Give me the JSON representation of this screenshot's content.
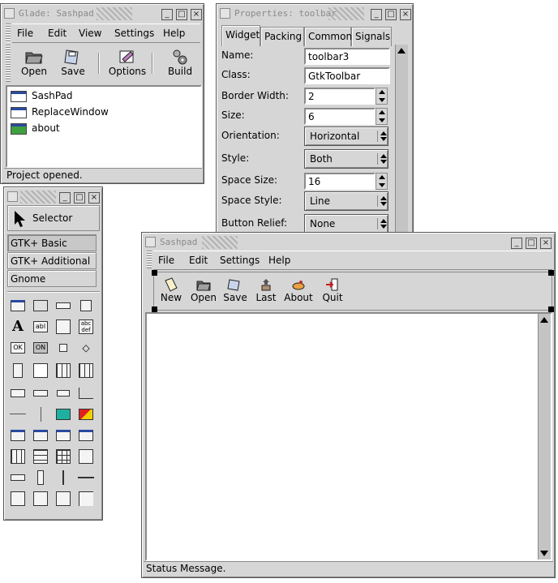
{
  "glade": {
    "title": "Glade: Sashpad",
    "menu": [
      {
        "label": "File"
      },
      {
        "label": "Edit"
      },
      {
        "label": "View"
      },
      {
        "label": "Settings"
      },
      {
        "label": "Help"
      }
    ],
    "toolbar": [
      {
        "label": "Open",
        "icon": "open-folder-icon"
      },
      {
        "label": "Save",
        "icon": "save-disk-icon"
      },
      {
        "label": "Options",
        "icon": "options-icon"
      },
      {
        "label": "Build",
        "icon": "build-gears-icon"
      }
    ],
    "project_items": [
      {
        "label": "SashPad"
      },
      {
        "label": "ReplaceWindow"
      },
      {
        "label": "about"
      }
    ],
    "status": "Project opened."
  },
  "properties": {
    "title": "Properties: toolbar",
    "tabs": [
      {
        "label": "Widget"
      },
      {
        "label": "Packing"
      },
      {
        "label": "Common"
      },
      {
        "label": "Signals"
      }
    ],
    "fields": {
      "name": {
        "label": "Name:",
        "value": "toolbar3"
      },
      "class": {
        "label": "Class:",
        "value": "GtkToolbar"
      },
      "border_width": {
        "label": "Border Width:",
        "value": "2"
      },
      "size": {
        "label": "Size:",
        "value": "6"
      },
      "orientation": {
        "label": "Orientation:",
        "value": "Horizontal"
      },
      "style": {
        "label": "Style:",
        "value": "Both"
      },
      "space_size": {
        "label": "Space Size:",
        "value": "16"
      },
      "space_style": {
        "label": "Space Style:",
        "value": "Line"
      },
      "button_relief": {
        "label": "Button Relief:",
        "value": "None"
      }
    }
  },
  "palette": {
    "selector": "Selector",
    "groups": [
      {
        "label": "GTK+ Basic"
      },
      {
        "label": "GTK+ Additional"
      },
      {
        "label": "Gnome"
      }
    ],
    "glyphs": {
      "label_a": "A",
      "entry": "abl",
      "text": "abc def",
      "ok": "OK",
      "on": "ON"
    }
  },
  "sashpad": {
    "title": "Sashpad",
    "menu": [
      {
        "label": "File"
      },
      {
        "label": "Edit"
      },
      {
        "label": "Settings"
      },
      {
        "label": "Help"
      }
    ],
    "toolbar": [
      {
        "label": "New"
      },
      {
        "label": "Open"
      },
      {
        "label": "Save"
      },
      {
        "label": "Last"
      },
      {
        "label": "About"
      },
      {
        "label": "Quit"
      }
    ],
    "status": "Status Message."
  },
  "colors": {
    "chrome": "#d6d6d6",
    "title_text": "#8a8a8a",
    "selection_blue": "#2a4aa0"
  }
}
